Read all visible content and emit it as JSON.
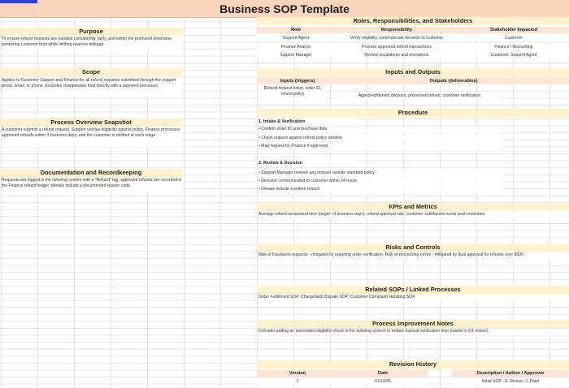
{
  "title": "Business SOP Template",
  "left": {
    "purpose": {
      "header": "Purpose",
      "text": "To ensure refund requests are handled consistently, fairly, and within the promised timeframe, protecting customer trust while limiting revenue leakage."
    },
    "scope": {
      "header": "Scope",
      "text": "Applies to Customer Support and Finance for all refund requests submitted through the support portal, email, or phone. Excludes chargebacks filed directly with a payment processor."
    },
    "overview": {
      "header": "Process Overview Snapshot",
      "text": "A customer submits a refund request. Support verifies eligibility against policy, Finance processes approved refunds within 3 business days, and the customer is notified at each stage."
    },
    "documentation": {
      "header": "Documentation and Recordkeeping",
      "text": "Requests are logged in the ticketing system with a \"Refund\" tag; approved refunds are recorded in the Finance refund ledger; denials include a documented reason code."
    }
  },
  "roles": {
    "header": "Roles, Responsibilities, and Stakeholders",
    "columns": [
      "Role",
      "Responsibility",
      "Stakeholder Impacted"
    ],
    "rows": [
      [
        "Support Agent",
        "Verify eligibility, communicate decision to customer",
        "Customer"
      ],
      [
        "Finance Analyst",
        "Process approved refund transactions",
        "Finance / Accounting"
      ],
      [
        "Support Manager",
        "Review escalations and exceptions",
        "Customer, Support Agent"
      ]
    ]
  },
  "io": {
    "header": "Inputs and Outputs",
    "inputs_label": "Inputs (triggers)",
    "outputs_label": "Outputs (deliverables)",
    "inputs_text": "Refund request ticket, order ID, refund policy",
    "outputs_text": "Approved/denied decision, processed refund, customer notification"
  },
  "procedure": {
    "header": "Procedure",
    "steps": [
      {
        "title": "1. Intake & Verification",
        "items": [
          "• Confirm order ID and purchase date",
          "• Check request against refund policy window",
          "• Flag request for Finance if approved"
        ]
      },
      {
        "title": "2. Review & Decision",
        "items": [
          "• Support Manager reviews any request outside standard policy",
          "• Decision communicated to customer within 24 hours",
          "• Denials include a written reason"
        ]
      }
    ]
  },
  "kpis": {
    "header": "KPIs and Metrics",
    "text": "Average refund turnaround time (target <3 business days), refund approval rate, customer satisfaction score post-resolution."
  },
  "risks": {
    "header": "Risks and Controls",
    "text": "Risk of fraudulent requests - mitigated by requiring order verification. Risk of processing errors - mitigated by dual approval for refunds over $500."
  },
  "related": {
    "header": "Related SOPs / Linked Processes",
    "text": "Order Fulfillment SOP, Chargeback Dispute SOP, Customer Complaint Handling SOP."
  },
  "improvement": {
    "header": "Process Improvement Notes",
    "text": "Consider adding an automated eligibility check in the ticketing system to reduce manual verification time (raised in Q1 review)."
  },
  "revision": {
    "header": "Revision History",
    "columns": [
      "Version",
      "Date",
      "Description / Author / Approver"
    ],
    "rows": [
      [
        "1",
        "01/10/25",
        "Initial SOP - A. Rivera / J. Patel"
      ]
    ]
  },
  "colors": {
    "title_bg": "#fbd4bd",
    "section_header_bg": "#fff2cc",
    "column_header_bg": "#fce4d6",
    "selection": "#3a3ad6"
  }
}
